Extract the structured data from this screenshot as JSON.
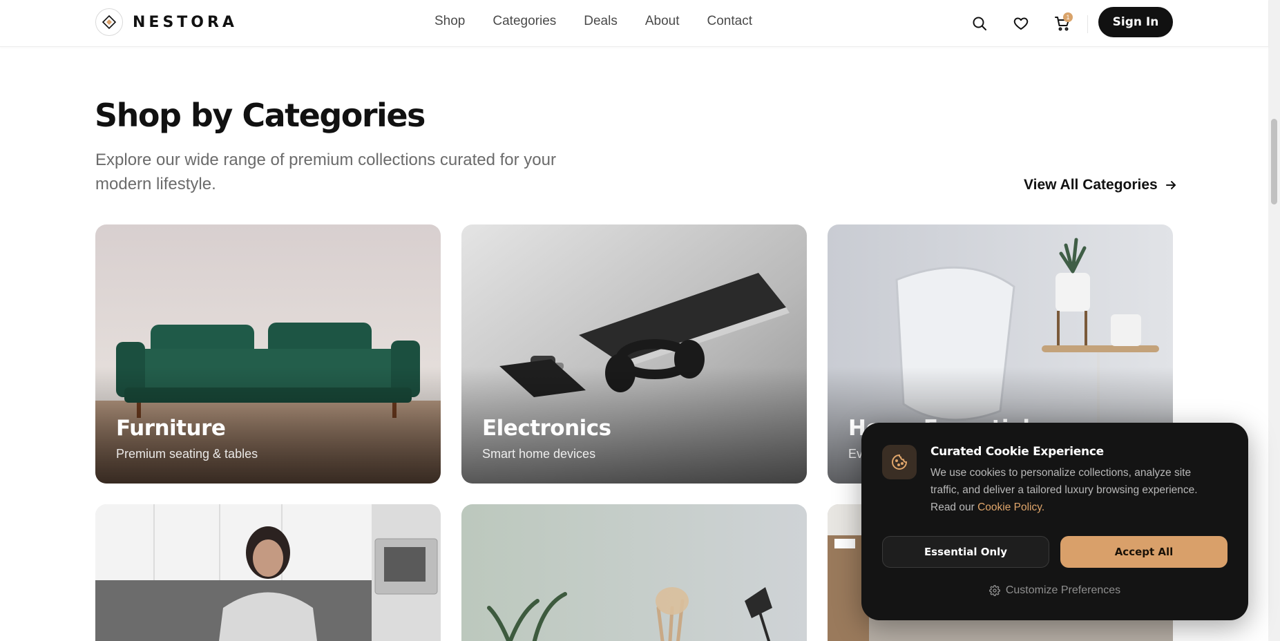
{
  "brand": {
    "name": "NESTORA"
  },
  "nav": {
    "items": [
      {
        "label": "Shop"
      },
      {
        "label": "Categories"
      },
      {
        "label": "Deals"
      },
      {
        "label": "About"
      },
      {
        "label": "Contact"
      }
    ]
  },
  "header": {
    "icons": [
      "search-icon",
      "heart-icon",
      "cart-icon"
    ],
    "cart_count": "1",
    "sign_in_label": "Sign In"
  },
  "section": {
    "title": "Shop by Categories",
    "subtitle": "Explore our wide range of premium collections curated for your modern lifestyle.",
    "view_all_label": "View All Categories"
  },
  "categories": [
    {
      "title": "Furniture",
      "subtitle": "Premium seating & tables"
    },
    {
      "title": "Electronics",
      "subtitle": "Smart home devices"
    },
    {
      "title": "Home Essentials",
      "subtitle": "Ev"
    },
    {
      "title": "",
      "subtitle": ""
    },
    {
      "title": "",
      "subtitle": ""
    },
    {
      "title": "",
      "subtitle": ""
    }
  ],
  "cookie": {
    "title": "Curated Cookie Experience",
    "body": "We use cookies to personalize collections, analyze site traffic, and deliver a tailored luxury browsing experience. Read our ",
    "link_label": "Cookie Policy",
    "link_suffix": ".",
    "essential_label": "Essential Only",
    "accept_label": "Accept All",
    "customize_label": "Customize Preferences"
  },
  "colors": {
    "accent": "#d9a06a",
    "dark": "#111111",
    "popup_bg": "#141414"
  }
}
